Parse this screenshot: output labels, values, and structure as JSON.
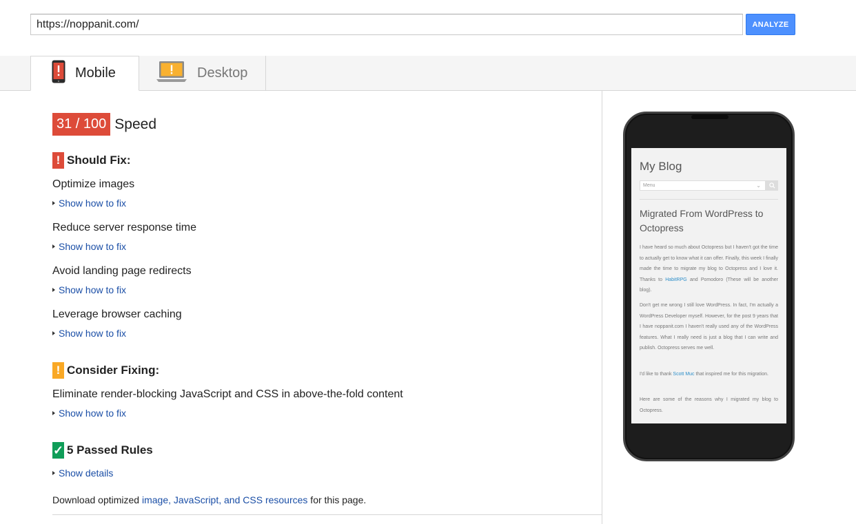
{
  "url_bar": {
    "value": "https://noppanit.com/",
    "analyze_label": "ANALYZE"
  },
  "tabs": [
    {
      "label": "Mobile",
      "icon": "mobile-warning-icon",
      "active": true
    },
    {
      "label": "Desktop",
      "icon": "desktop-warning-icon",
      "active": false
    }
  ],
  "score": {
    "value": "31 / 100",
    "label": "Speed",
    "color": "#dd4b39"
  },
  "should_fix": {
    "title": "Should Fix:",
    "rules": [
      {
        "title": "Optimize images",
        "link": "Show how to fix"
      },
      {
        "title": "Reduce server response time",
        "link": "Show how to fix"
      },
      {
        "title": "Avoid landing page redirects",
        "link": "Show how to fix"
      },
      {
        "title": "Leverage browser caching",
        "link": "Show how to fix"
      }
    ]
  },
  "consider_fixing": {
    "title": "Consider Fixing:",
    "rules": [
      {
        "title": "Eliminate render-blocking JavaScript and CSS in above-the-fold content",
        "link": "Show how to fix"
      }
    ]
  },
  "passed": {
    "title": "5 Passed Rules",
    "link": "Show details"
  },
  "download": {
    "prefix": "Download optimized ",
    "link": "image, JavaScript, and CSS resources",
    "suffix": " for this page."
  },
  "preview": {
    "blog_title": "My Blog",
    "menu_label": "Menu",
    "post_title": "Migrated From WordPress to Octopress",
    "para1_a": "I have heard so much about Octopress but I haven't got the time to actually get to know what it can offer. Finally, this week I finally made the time to migrate my blog to Octopress and I love it. Thanks to ",
    "para1_link": "HabitRPG",
    "para1_b": " and Pomodoro (These will be another blog).",
    "para2": "Don't get me wrong I still love WordPress. In fact, I'm actually a WordPress Developer myself. However, for the post 9 years that I have noppanit.com I haven't really used any of the WordPress features. What I really need is just a blog that I can write and publish. Octopress serves me well.",
    "para3_a": "I'd like to thank ",
    "para3_link": "Scott Muc",
    "para3_b": " that inspired me for this migration.",
    "para4": "Here are some of the reasons why I migrated my blog to Octopress."
  },
  "colors": {
    "accent": "#4d90fe",
    "fail": "#dd4b39",
    "warn": "#f9a825",
    "pass": "#0f9d58",
    "link": "#1a4ea6"
  }
}
